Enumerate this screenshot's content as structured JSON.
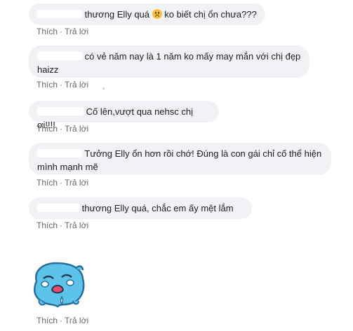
{
  "actions": {
    "like": "Thích",
    "reply": "Trả lời",
    "separator": "·"
  },
  "comments": [
    {
      "text": "thương Elly quá",
      "text_after_emoji": "ko biết chị ổn chưa???",
      "emoji": "sad-face-emoji"
    },
    {
      "line1": "có vẻ năm nay là 1 năm ko mấy may mắn với chị đẹp",
      "line2": "haizz"
    },
    {
      "text": "Cố lên,vượt qua nehsc chị ơi!!!!"
    },
    {
      "line1": "Tưởng Elly ổn hơn rồi chớ! Đúng là con gái chỉ cố thể hiện",
      "line2": "mình mạnh mẽ"
    },
    {
      "text": "thương Elly quá, chắc em ấy mệt lắm"
    }
  ],
  "sticker": {
    "icon": "crying-blob-sticker",
    "colors": {
      "body": "#5ec3e8",
      "outline": "#2a6f9c",
      "tear": "#ffffff"
    }
  }
}
